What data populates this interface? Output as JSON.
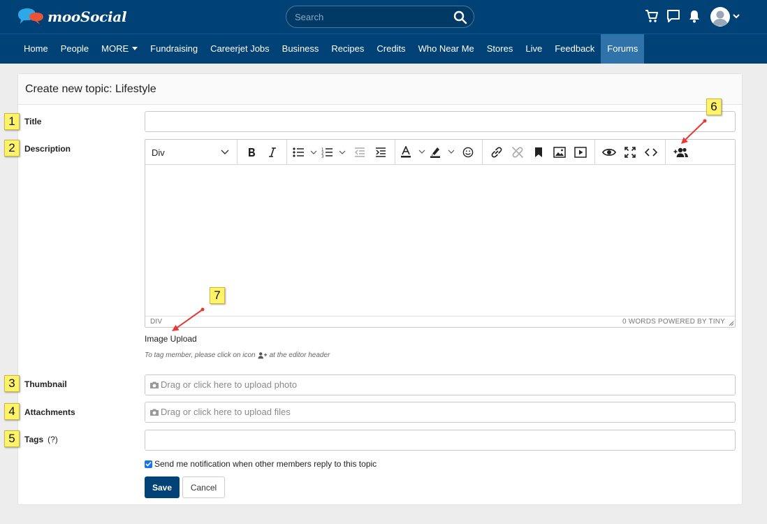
{
  "header": {
    "logo_text": "mooSocial",
    "search_placeholder": "Search"
  },
  "nav": {
    "items": [
      "Home",
      "People",
      "MORE",
      "Fundraising",
      "Careerjet Jobs",
      "Business",
      "Recipes",
      "Credits",
      "Who Near Me",
      "Stores",
      "Live",
      "Feedback",
      "Forums"
    ],
    "active": "Forums"
  },
  "form": {
    "title": "Create new topic: Lifestyle",
    "labels": {
      "title": "Title",
      "description": "Description",
      "thumbnail": "Thumbnail",
      "attachments": "Attachments",
      "tags": "Tags",
      "tags_help": "(?)"
    },
    "editor": {
      "block_format": "Div",
      "status_path": "DIV",
      "status_words": "0 WORDS  POWERED BY TINY"
    },
    "image_upload": "Image Upload",
    "hint_before": "To tag member, please click on icon",
    "hint_after": "at the editor header",
    "thumbnail_placeholder": "Drag or click here to upload photo",
    "attachments_placeholder": "Drag or click here to upload files",
    "notify_label": "Send me notification when other members reply to this topic",
    "save_label": "Save",
    "cancel_label": "Cancel"
  },
  "callouts": [
    "1",
    "2",
    "3",
    "4",
    "5",
    "6",
    "7"
  ],
  "colors": {
    "header_bg": "#004176",
    "nav_active": "#2f73aa",
    "save_bg": "#004176",
    "callout_bg": "#fff36a",
    "arrow": "#e53935"
  }
}
